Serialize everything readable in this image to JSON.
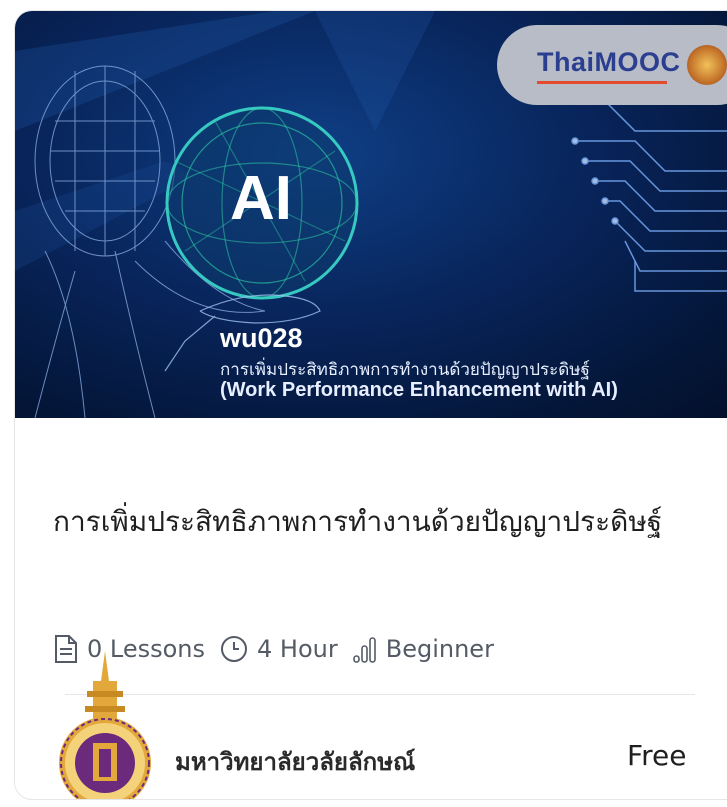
{
  "course": {
    "thumbnail": {
      "brand_logo": "ThaiMOOC",
      "ai_label": "AI",
      "code": "wu028",
      "subtitle_th": "การเพิ่มประสิทธิภาพการทำงานด้วยปัญญาประดิษฐ์",
      "subtitle_en": "(Work Performance Enhancement with AI)"
    },
    "title": "การเพิ่มประสิทธิภาพการทำงานด้วยปัญญาประดิษฐ์",
    "meta": {
      "lessons_icon": "document-icon",
      "lessons": "0 Lessons",
      "duration_icon": "clock-icon",
      "duration": "4 Hour",
      "level_icon": "signal-bars-icon",
      "level": "Beginner"
    },
    "university": "มหาวิทยาลัยวลัยลักษณ์",
    "university_logo": "university-seal-icon",
    "price": "Free"
  },
  "colors": {
    "banner_bg": "#08245a",
    "badge_bg": "#b7bcc6",
    "text_primary": "#1f1f1f",
    "text_meta": "#555b66",
    "seal_purple": "#6c2a7d",
    "seal_gold": "#e2a83b"
  }
}
